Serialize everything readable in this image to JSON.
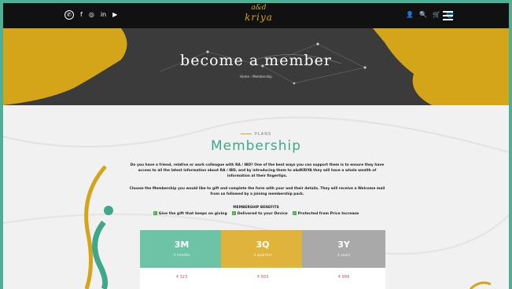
{
  "nav": {
    "social": [
      {
        "icon": "whatsapp-icon",
        "glyph": "✆"
      },
      {
        "icon": "facebook-icon",
        "glyph": "f"
      },
      {
        "icon": "instagram-icon",
        "glyph": "◎"
      },
      {
        "icon": "linkedin-icon",
        "glyph": "in"
      },
      {
        "icon": "youtube-icon",
        "glyph": "▶"
      }
    ],
    "logo_top": "a&d",
    "logo_main": "kriya",
    "icons": [
      {
        "icon": "user-icon",
        "glyph": "👤"
      },
      {
        "icon": "search-icon",
        "glyph": "🔍"
      },
      {
        "icon": "cart-icon",
        "glyph": "🛒"
      },
      {
        "icon": "language-icon",
        "glyph": "🌐"
      }
    ]
  },
  "hero": {
    "title": "become a member",
    "breadcrumb": "Home › Membership"
  },
  "section": {
    "label": "PLANS",
    "title": "Membership",
    "paragraph1": "Do you have a friend, relative or work colleague with RA / IBD? One of the best ways you can support them is to ensure they have access to all the latest information about RA / IBD, and by introducing them to a&dKRIYA they will have a whole wealth of information at their fingertips.",
    "paragraph2": "Choose the Membership you would like to gift and complete the form with your and their details. They will receive a Welcome mail from us followed by a joining membership pack.",
    "benefits_title": "MEMBERSHIP BENEFITS",
    "benefits": [
      "Give the gift that keeps on giving",
      "Delivered to your Device",
      "Protected from Price Increase"
    ]
  },
  "plans": [
    {
      "code": "3M",
      "duration": "3 months",
      "price": "₹ 323",
      "color": "#6cc3a5"
    },
    {
      "code": "3Q",
      "duration": "3 quarters",
      "price": "₹ 503",
      "color": "#e0b33a"
    },
    {
      "code": "3Y",
      "duration": "3 years",
      "price": "₹ 999",
      "color": "#a9a9a9"
    }
  ],
  "colors": {
    "accent_green": "#3fa88a",
    "accent_gold": "#d4a419",
    "frame": "#4fae93"
  }
}
